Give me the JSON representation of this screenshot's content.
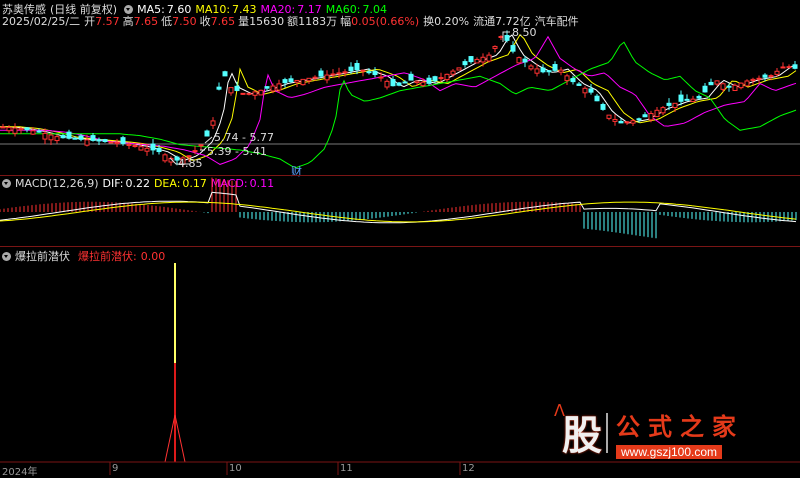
{
  "header": {
    "stock_name": "苏奥传感",
    "period_mode": "(日线 前复权)",
    "ma5_label": "MA5:",
    "ma5_value": "7.60",
    "ma10_label": "MA10:",
    "ma10_value": "7.43",
    "ma20_label": "MA20:",
    "ma20_value": "7.17",
    "ma60_label": "MA60:",
    "ma60_value": "7.04"
  },
  "quote": {
    "date": "2025/02/25/二",
    "open_label": "开",
    "open": "7.57",
    "high_label": "高",
    "high": "7.65",
    "low_label": "低",
    "low": "7.50",
    "close_label": "收",
    "close": "7.65",
    "vol_label": "量",
    "vol": "15630",
    "amount_label": "额",
    "amount": "1183万",
    "change_label": "幅",
    "change": "0.05(0.66%)",
    "turnover_label": "换",
    "turnover": "0.20%",
    "float_label": "流通",
    "float": "7.72亿",
    "sector": "汽车配件"
  },
  "annotations": {
    "high_mark": "8.50",
    "low_mark": "4.85",
    "range_a": "5.74 - 5.77",
    "range_b": "5.39 - 5.41",
    "finance_tag": "财"
  },
  "macd": {
    "title": "MACD(12,26,9)",
    "dif_label": "DIF:",
    "dif": "0.22",
    "dea_label": "DEA:",
    "dea": "0.17",
    "macd_label": "MACD:",
    "macd": "0.11"
  },
  "indicator": {
    "name": "爆拉前潜伏",
    "series_label": "爆拉前潜伏:",
    "value": "0.00"
  },
  "xaxis": {
    "labels": [
      "2024年",
      "9",
      "10",
      "11",
      "12"
    ]
  },
  "watermark": {
    "glyph": "股",
    "title": "公式之家",
    "url": "www.gszj100.com"
  },
  "colors": {
    "background": "#000000",
    "rise": "#ff3232",
    "fall": "#54ffff",
    "ma5": "#ffffff",
    "ma10": "#ffff00",
    "ma20": "#ff00ff",
    "ma60": "#00ff00",
    "separator": "#7a1515"
  }
}
